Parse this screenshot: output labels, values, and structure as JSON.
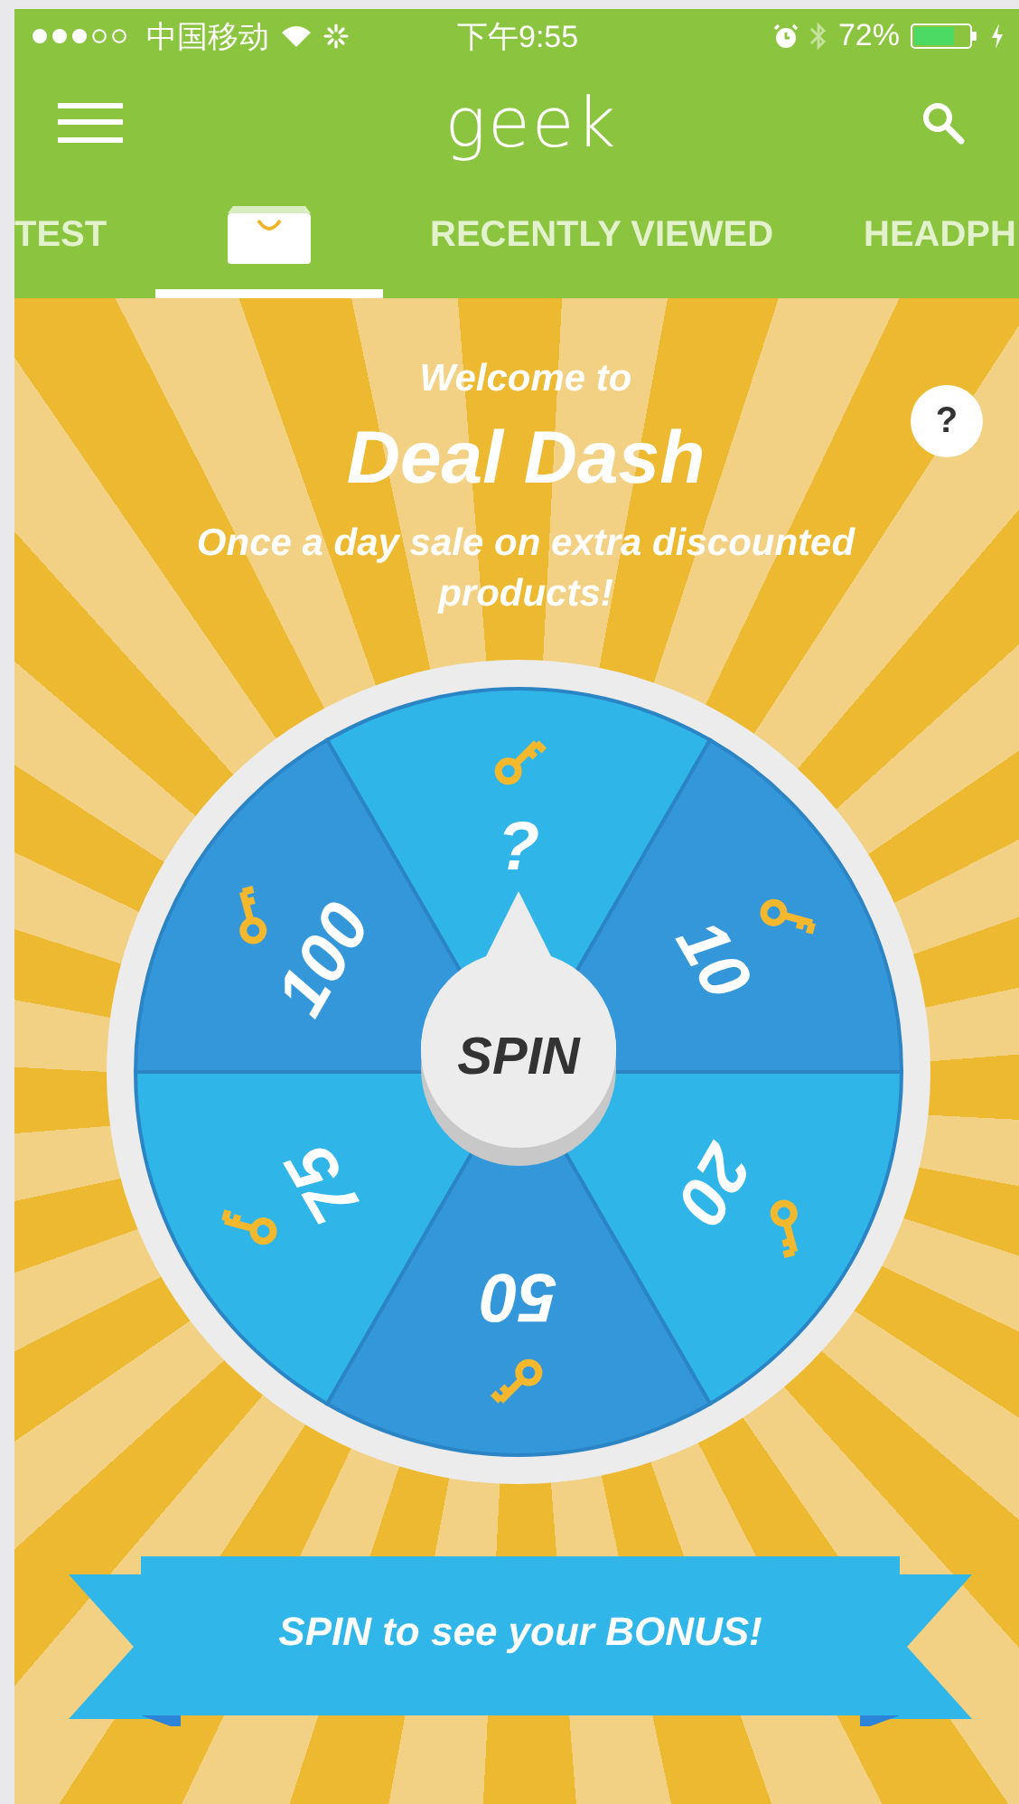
{
  "status_bar": {
    "carrier": "中国移动",
    "time": "下午9:55",
    "battery": "72%"
  },
  "app_bar": {
    "logo": "geek"
  },
  "tabs": [
    {
      "kind": "text",
      "label": "TEST",
      "selected": false
    },
    {
      "kind": "icon",
      "selected": true
    },
    {
      "kind": "text",
      "label": "RECENTLY VIEWED",
      "selected": false
    },
    {
      "kind": "text",
      "label": "HEADPH",
      "selected": false
    }
  ],
  "promo": {
    "welcome": "Welcome to",
    "title": "Deal Dash",
    "subtitle": "Once a day sale on extra discounted products!",
    "help": "?"
  },
  "wheel": {
    "segments": [
      {
        "label": "?",
        "color": "#2fb5e8"
      },
      {
        "label": "10",
        "color": "#3497da"
      },
      {
        "label": "20",
        "color": "#2fb5e8"
      },
      {
        "label": "50",
        "color": "#3497da"
      },
      {
        "label": "75",
        "color": "#2fb5e8"
      },
      {
        "label": "100",
        "color": "#3497da"
      }
    ],
    "spin_button": "SPIN"
  },
  "banner": "SPIN to see your BONUS!"
}
